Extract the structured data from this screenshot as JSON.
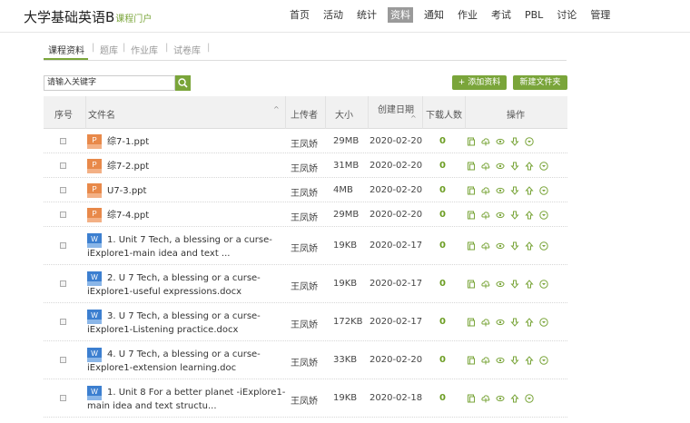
{
  "header": {
    "course_title": "大学基础英语B",
    "course_sub": "课程门户",
    "nav": [
      "首页",
      "活动",
      "统计",
      "资料",
      "通知",
      "作业",
      "考试",
      "PBL",
      "讨论",
      "管理"
    ],
    "active_nav": "资料"
  },
  "subtabs": [
    "课程资料",
    "题库",
    "作业库",
    "试卷库"
  ],
  "search": {
    "value": "请输入关键字"
  },
  "buttons": {
    "add": "+ 添加资料",
    "new_folder": "新建文件夹"
  },
  "table": {
    "headers": {
      "seq": "序号",
      "name": "文件名",
      "uploader": "上传者",
      "size": "大小",
      "date": "创建日期",
      "downloads": "下载人数",
      "ops": "操作"
    },
    "rows": [
      {
        "type": "ppt",
        "name_lines": [
          "综7-1.ppt"
        ],
        "uploader": "王凤娇",
        "size": "29MB",
        "date": "2020-02-20",
        "downloads": "0",
        "ops": [
          "doc-icon",
          "cloud-upload-icon",
          "eye-icon",
          "download-icon",
          "chevron-down-circle-icon"
        ]
      },
      {
        "type": "ppt",
        "name_lines": [
          "综7-2.ppt"
        ],
        "uploader": "王凤娇",
        "size": "31MB",
        "date": "2020-02-20",
        "downloads": "0",
        "ops": [
          "doc-icon",
          "cloud-upload-icon",
          "eye-icon",
          "download-icon",
          "upload-icon",
          "chevron-down-circle-icon"
        ]
      },
      {
        "type": "ppt",
        "name_lines": [
          "U7-3.ppt"
        ],
        "uploader": "王凤娇",
        "size": "4MB",
        "date": "2020-02-20",
        "downloads": "0",
        "ops": [
          "doc-icon",
          "cloud-upload-icon",
          "eye-icon",
          "download-icon",
          "upload-icon",
          "chevron-down-circle-icon"
        ]
      },
      {
        "type": "ppt",
        "name_lines": [
          "综7-4.ppt"
        ],
        "uploader": "王凤娇",
        "size": "29MB",
        "date": "2020-02-20",
        "downloads": "0",
        "ops": [
          "doc-icon",
          "cloud-upload-icon",
          "eye-icon",
          "download-icon",
          "upload-icon",
          "chevron-down-circle-icon"
        ]
      },
      {
        "type": "word",
        "name_lines": [
          "1. Unit 7 Tech, a blessing or a curse-",
          "iExplore1-main idea and text ..."
        ],
        "uploader": "王凤娇",
        "size": "19KB",
        "date": "2020-02-17",
        "downloads": "0",
        "ops": [
          "doc-icon",
          "cloud-upload-icon",
          "eye-icon",
          "download-icon",
          "upload-icon",
          "chevron-down-circle-icon"
        ]
      },
      {
        "type": "word",
        "name_lines": [
          "2. U 7 Tech, a blessing or a curse-",
          "iExplore1-useful expressions.docx"
        ],
        "uploader": "王凤娇",
        "size": "19KB",
        "date": "2020-02-17",
        "downloads": "0",
        "ops": [
          "doc-icon",
          "cloud-upload-icon",
          "eye-icon",
          "download-icon",
          "upload-icon",
          "chevron-down-circle-icon"
        ]
      },
      {
        "type": "word",
        "name_lines": [
          "3. U 7 Tech, a blessing or a curse-",
          "iExplore1-Listening practice.docx"
        ],
        "uploader": "王凤娇",
        "size": "172KB",
        "date": "2020-02-17",
        "downloads": "0",
        "ops": [
          "doc-icon",
          "cloud-upload-icon",
          "eye-icon",
          "download-icon",
          "upload-icon",
          "chevron-down-circle-icon"
        ]
      },
      {
        "type": "word",
        "name_lines": [
          "4. U 7 Tech, a blessing or a curse-",
          "iExplore1-extension learning.doc"
        ],
        "uploader": "王凤娇",
        "size": "33KB",
        "date": "2020-02-20",
        "downloads": "0",
        "ops": [
          "doc-icon",
          "cloud-upload-icon",
          "eye-icon",
          "download-icon",
          "upload-icon",
          "chevron-down-circle-icon"
        ]
      },
      {
        "type": "word",
        "name_lines": [
          "1. Unit 8 For a better planet -iExplore1-",
          "main idea and text structu..."
        ],
        "uploader": "王凤娇",
        "size": "19KB",
        "date": "2020-02-18",
        "downloads": "0",
        "ops": [
          "doc-icon",
          "cloud-upload-icon",
          "eye-icon",
          "upload-icon",
          "chevron-down-circle-icon"
        ]
      }
    ]
  },
  "colors": {
    "accent": "#7aa53a",
    "nav_active_bg": "#9a9a9a",
    "ppt_icon": "#e8894a",
    "word_icon": "#3c7fd0"
  }
}
